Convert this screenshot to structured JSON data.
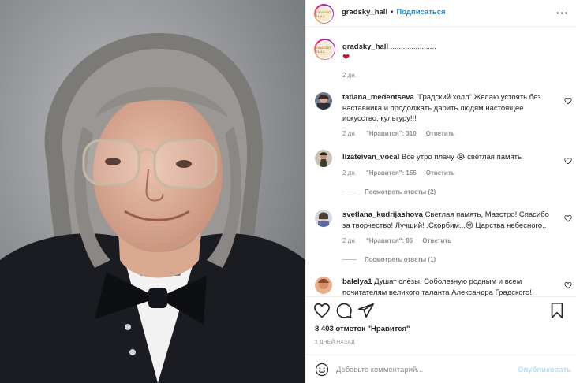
{
  "post": {
    "username": "gradsky_hall",
    "follow_label": "Подписаться",
    "more_icon": "more-horizontal-icon",
    "logo_text": "GRADSKY HALL",
    "caption_text": "......................",
    "caption_emoji": "❤",
    "caption_time": "2 дн.",
    "likes": "8 403 отметок \"Нравится\"",
    "date": "2 ДНЕЙ НАЗАД",
    "comment_placeholder": "Добавьте комментарий...",
    "publish_label": "Опубликовать"
  },
  "comments": [
    {
      "username": "tatiana_medentseva",
      "text": "\"Градский холл\" Желаю устоять без наставника и продолжать дарить людям настоящее искусство, культуру!!!",
      "time": "2 дн.",
      "likes": "\"Нравится\": 310",
      "reply": "Ответить"
    },
    {
      "username": "lizateivan_vocal",
      "text": "Все утро плачу 😭 светлая память",
      "time": "2 дн.",
      "likes": "\"Нравится\": 155",
      "reply": "Ответить",
      "view_replies": "Посмотреть ответы (2)"
    },
    {
      "username": "svetlana_kudrijashova",
      "text": "Светлая память, Маэстро! Спасибо за творчество! Лучший! .Скорбим...😔 Царства небесного..",
      "time": "2 дн.",
      "likes": "\"Нравится\": 86",
      "reply": "Ответить",
      "view_replies": "Посмотреть ответы (1)"
    },
    {
      "username": "balelya1",
      "text": "Душат слёзы. Соболезную родным и всем почитателям великого таланта Александра Градского!"
    }
  ],
  "colors": {
    "accent": "#0095f6",
    "publish_disabled": "#b2dffc",
    "muted": "#8e8e8e",
    "caption_heart": "#c0182b"
  }
}
